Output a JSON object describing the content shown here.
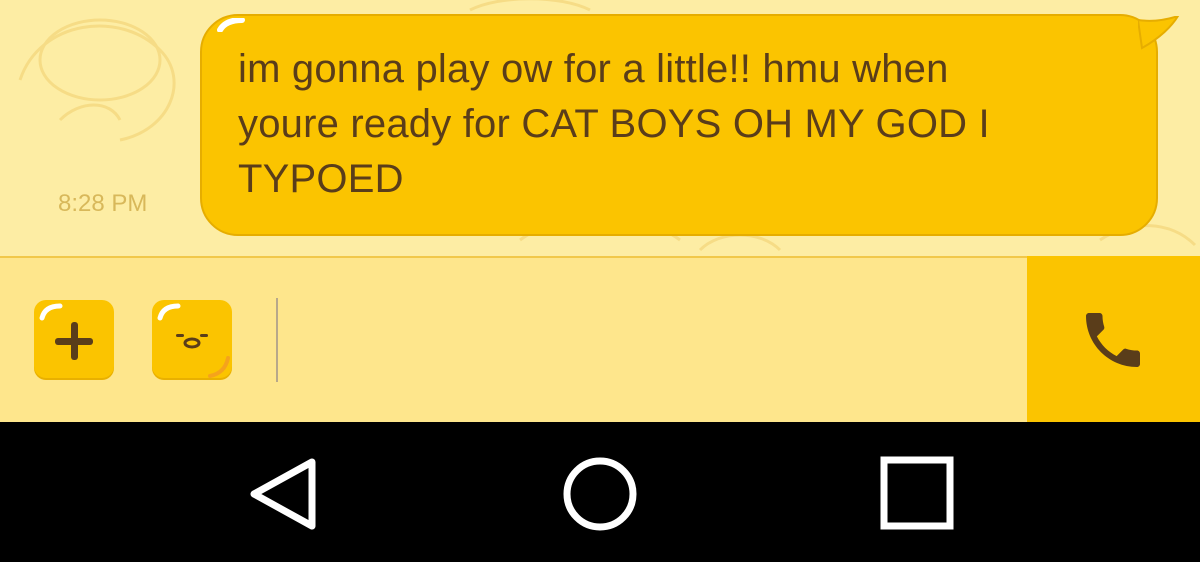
{
  "message": {
    "text_lines": [
      "im gonna play ow for a little!! hmu when",
      "youre ready for CAT BOYS OH MY GOD I",
      "TYPOED"
    ],
    "timestamp": "8:28 PM"
  },
  "composer": {
    "plus_icon": "plus-icon",
    "sticker_icon": "gudetama-sticker-icon",
    "call_icon": "phone-icon"
  },
  "navbar": {
    "back_icon": "back-triangle-icon",
    "home_icon": "home-circle-icon",
    "recents_icon": "recents-square-icon"
  },
  "colors": {
    "bubble": "#fbc400",
    "background": "#fdeda4",
    "composer": "#fee68c",
    "text": "#5a3d1a",
    "timestamp": "#d8b85a",
    "navbar": "#000000"
  }
}
